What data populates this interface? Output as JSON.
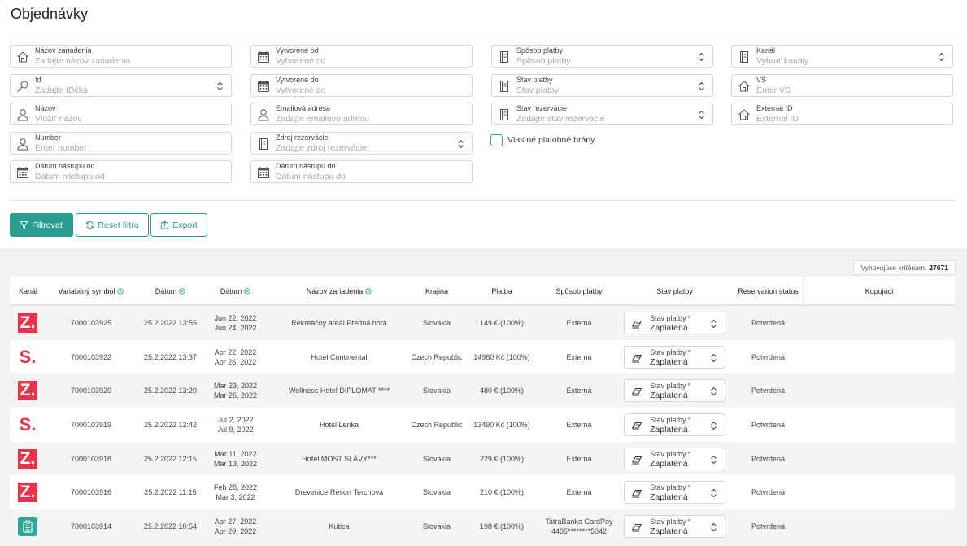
{
  "page_title": "Objednávky",
  "filters": {
    "facility_name": {
      "label": "Názov zariadenia",
      "placeholder": "Zadajte názov zariadenia"
    },
    "created_from": {
      "label": "Vytvorené od",
      "placeholder": "Vytvorené od"
    },
    "payment_method": {
      "label": "Spôsob platby",
      "placeholder": "Spôsob platby"
    },
    "channel": {
      "label": "Kanál",
      "placeholder": "Vybrať kanály"
    },
    "id": {
      "label": "Id",
      "placeholder": "Zadajte IDčka"
    },
    "created_to": {
      "label": "Vytvorené do",
      "placeholder": "Vytvorené do"
    },
    "payment_status": {
      "label": "Stav platby",
      "placeholder": "Stav platby"
    },
    "vs": {
      "label": "VS",
      "placeholder": "Enter VS"
    },
    "name": {
      "label": "Názov",
      "placeholder": "Vložiť názov"
    },
    "email": {
      "label": "Emailová adresa",
      "placeholder": "Zadajte emailovú adresu"
    },
    "reservation_status": {
      "label": "Stav rezervácie",
      "placeholder": "Zadajte stav rezervácie"
    },
    "external_id": {
      "label": "External ID",
      "placeholder": "External ID"
    },
    "number": {
      "label": "Number",
      "placeholder": "Enter number"
    },
    "reservation_source": {
      "label": "Zdroj rezervácie",
      "placeholder": "Zadajte zdroj rezervácie"
    },
    "custom_gateways_label": "Vlastné platobné brány",
    "checkin_from": {
      "label": "Dátum nástupu od",
      "placeholder": "Dátum nástupu od"
    },
    "checkin_to": {
      "label": "Dátum nástupu do",
      "placeholder": "Dátum nástupu do"
    }
  },
  "buttons": {
    "filter": "Filtrovať",
    "reset": "Reset filtra",
    "export": "Export"
  },
  "results": {
    "count_label": "Vyhovujúce kritériam:",
    "count": "27671"
  },
  "table": {
    "headers": {
      "channel": "Kanál",
      "vs": "Variabilný symbol",
      "date": "Dátum",
      "date2": "Dátum",
      "facility": "Názov zariadenia",
      "country": "Krajina",
      "payment": "Platba",
      "payment_method": "Spôsob platby",
      "payment_status": "Stav platby",
      "reservation_status": "Reservation status",
      "buyer": "Kupujúci"
    },
    "status_label": "Stav platby",
    "rows": [
      {
        "channel": "Z.",
        "vs": "7000103925",
        "created": "25.2.2022 13:55",
        "from": "Jun 22, 2022",
        "to": "Jun 24, 2022",
        "facility": "Rekreačný areál Predná hora",
        "country": "Slovakia",
        "amount": "149 € (100%)",
        "method": "Externá",
        "method2": "",
        "pay_status": "Zaplatená",
        "res_status": "Potvrdená"
      },
      {
        "channel": "S.",
        "vs": "7000103922",
        "created": "25.2.2022 13:37",
        "from": "Apr 22, 2022",
        "to": "Apr 26, 2022",
        "facility": "Hotel Continental",
        "country": "Czech Republic",
        "amount": "14980 Kč (100%)",
        "method": "Externá",
        "method2": "",
        "pay_status": "Zaplatená",
        "res_status": "Potvrdená"
      },
      {
        "channel": "Z.",
        "vs": "7000103920",
        "created": "25.2.2022 13:20",
        "from": "Mar 23, 2022",
        "to": "Mar 26, 2022",
        "facility": "Wellness Hotel DIPLOMAT ****",
        "country": "Slovakia",
        "amount": "480 € (100%)",
        "method": "Externá",
        "method2": "",
        "pay_status": "Zaplatená",
        "res_status": "Potvrdená"
      },
      {
        "channel": "S.",
        "vs": "7000103919",
        "created": "25.2.2022 12:42",
        "from": "Jul 2, 2022",
        "to": "Jul 9, 2022",
        "facility": "Hotel Lenka",
        "country": "Czech Republic",
        "amount": "13490 Kč (100%)",
        "method": "Externá",
        "method2": "",
        "pay_status": "Zaplatená",
        "res_status": "Potvrdená"
      },
      {
        "channel": "Z.",
        "vs": "7000103918",
        "created": "25.2.2022 12:15",
        "from": "Mar 11, 2022",
        "to": "Mar 13, 2022",
        "facility": "Hotel MOST SLÁVY***",
        "country": "Slovakia",
        "amount": "229 € (100%)",
        "method": "Externá",
        "method2": "",
        "pay_status": "Zaplatená",
        "res_status": "Potvrdená"
      },
      {
        "channel": "Z.",
        "vs": "7000103916",
        "created": "25.2.2022 11:15",
        "from": "Feb 28, 2022",
        "to": "Mar 3, 2022",
        "facility": "Drevenice Resort Terchová",
        "country": "Slovakia",
        "amount": "210 € (100%)",
        "method": "Externá",
        "method2": "",
        "pay_status": "Zaplatená",
        "res_status": "Potvrdená"
      },
      {
        "channel": "clipboard",
        "vs": "7000103914",
        "created": "25.2.2022 10:54",
        "from": "Apr 27, 2022",
        "to": "Apr 29, 2022",
        "facility": "Kutica",
        "country": "Slovakia",
        "amount": "198 € (100%)",
        "method": "TatraBanka CardPay",
        "method2": "4405********5042",
        "pay_status": "Zaplatená",
        "res_status": "Potvrdená"
      }
    ]
  },
  "colors": {
    "accent": "#2a9d8f",
    "brand_red": "#e8334a"
  }
}
